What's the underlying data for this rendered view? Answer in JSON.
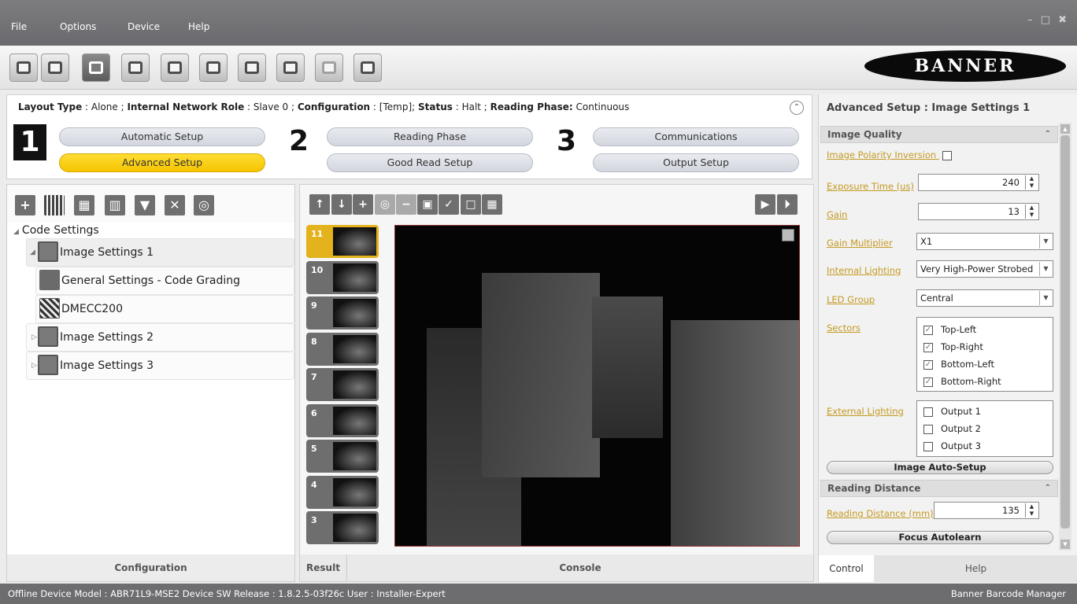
{
  "menu": {
    "file": "File",
    "options": "Options",
    "device": "Device",
    "help": "Help"
  },
  "window_controls": "– □ ✖",
  "logo": "BANNER",
  "info": {
    "layout_type_label": "Layout Type",
    "layout_type_value": " : Alone ; ",
    "network_role_label": "Internal Network Role",
    "network_role_value": " : Slave 0 ; ",
    "configuration_label": "Configuration",
    "configuration_value": " : [Temp]; ",
    "status_label": "Status",
    "status_value": " : Halt ; ",
    "reading_phase_label": "Reading Phase:",
    "reading_phase_value": " Continuous"
  },
  "steps": {
    "n1": "1",
    "n2": "2",
    "n3": "3",
    "automatic_setup": "Automatic Setup",
    "advanced_setup": "Advanced Setup",
    "reading_phase": "Reading Phase",
    "good_read_setup": "Good Read Setup",
    "communications": "Communications",
    "output_setup": "Output Setup"
  },
  "tree": {
    "code_settings": "Code Settings",
    "image_settings_1": "Image Settings  1",
    "general_settings": "General Settings - Code Grading",
    "dmecc200": "DMECC200",
    "image_settings_2": "Image Settings  2",
    "image_settings_3": "Image Settings  3"
  },
  "left_footer": "Configuration",
  "thumbnails": [
    "11",
    "10",
    "9",
    "8",
    "7",
    "6",
    "5",
    "4",
    "3"
  ],
  "center_footer": {
    "result": "Result",
    "console": "Console"
  },
  "right": {
    "title": "Advanced Setup : Image Settings  1",
    "image_quality": "Image Quality",
    "image_polarity_inversion": "Image Polarity Inversion",
    "exposure_time_label": "Exposure Time (us)",
    "exposure_time_value": "240",
    "gain_label": "Gain",
    "gain_value": "13",
    "gain_multiplier_label": "Gain Multiplier",
    "gain_multiplier_value": "X1",
    "internal_lighting_label": "Internal Lighting",
    "internal_lighting_value": "Very High-Power Strobed",
    "led_group_label": "LED Group",
    "led_group_value": "Central",
    "sectors_label": "Sectors",
    "sectors": [
      "Top-Left",
      "Top-Right",
      "Bottom-Left",
      "Bottom-Right"
    ],
    "external_lighting_label": "External Lighting",
    "external_outputs": [
      "Output 1",
      "Output 2",
      "Output 3"
    ],
    "image_auto_setup": "Image Auto-Setup",
    "reading_distance": "Reading Distance",
    "reading_distance_label": "Reading Distance (mm)",
    "reading_distance_value": "135",
    "focus_autolearn": "Focus Autolearn",
    "tab_control": "Control",
    "tab_help": "Help"
  },
  "status": {
    "left": "Offline Device Model : ABR71L9-MSE2   Device SW Release : 1.8.2.5-03f26c   User : Installer-Expert",
    "right": "Banner Barcode Manager"
  },
  "colors": {
    "accent": "#f5c400",
    "link": "#c49a22",
    "chrome": "#6d6d70"
  }
}
